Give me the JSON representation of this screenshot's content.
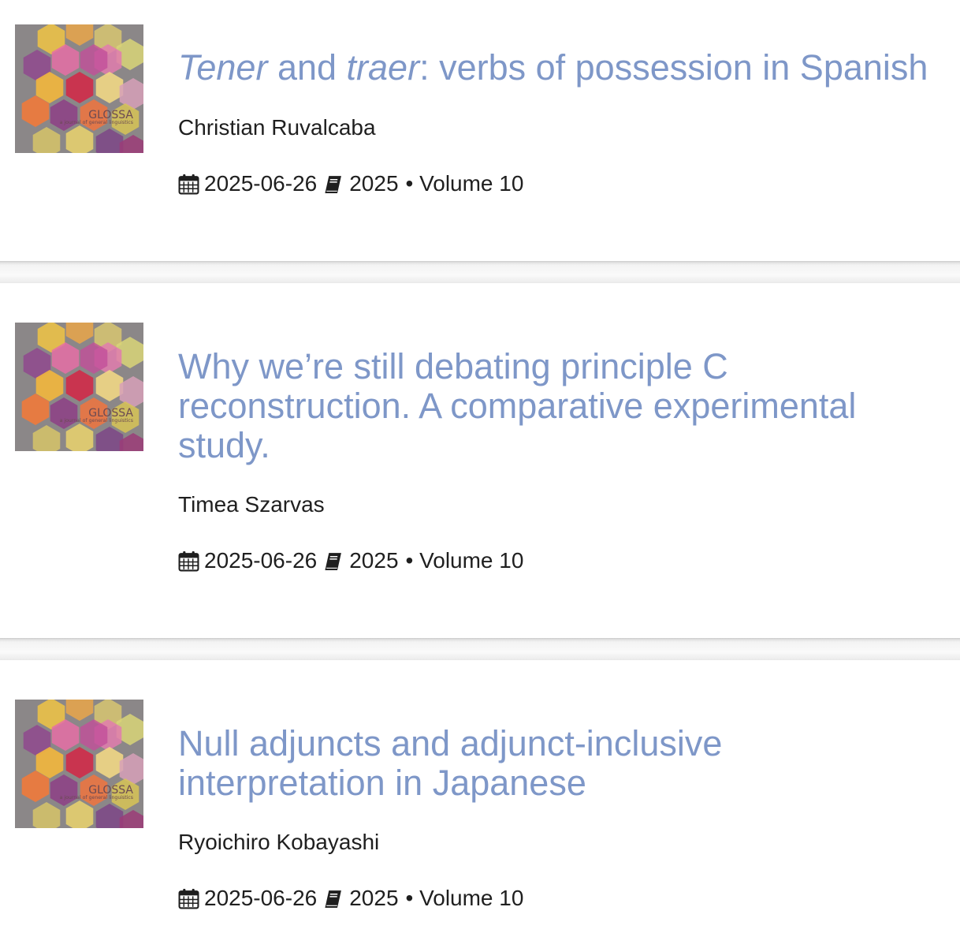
{
  "cover": {
    "logo_text": "GLOSSA",
    "logo_subtitle": "a journal of general linguistics"
  },
  "articles": [
    {
      "title_parts": [
        "Tener",
        " and ",
        "traer",
        ": verbs of possession in Spanish"
      ],
      "author": "Christian Ruvalcaba",
      "date": "2025-06-26",
      "year": "2025",
      "volume": "• Volume 10"
    },
    {
      "title": "Why we’re still debating principle C reconstruction. A comparative experimental study.",
      "author": "Timea Szarvas",
      "date": "2025-06-26",
      "year": "2025",
      "volume": "• Volume 10"
    },
    {
      "title": "Null adjuncts and adjunct-inclusive interpretation in Japanese",
      "author": "Ryoichiro Kobayashi",
      "date": "2025-06-26",
      "year": "2025",
      "volume": "• Volume 10"
    }
  ],
  "icons": {
    "date": "calendar-icon",
    "issue": "book-icon"
  },
  "colors": {
    "title": "#7e97c8",
    "text": "#1f1f1f",
    "cover_background": "#8b8788"
  }
}
